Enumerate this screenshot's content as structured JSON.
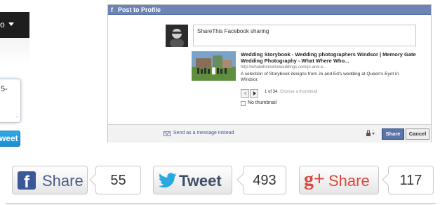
{
  "left_panel": {
    "bar_text": "o",
    "box_text": "5-",
    "tweet_label": "weet"
  },
  "fb_dialog": {
    "logo": "f",
    "title": "Post to Profile",
    "message": "ShareThis Facebook sharing",
    "link_title": "Wedding Storybook - Wedding photographers Windsor | Memory Gate Wedding Photography - What Where Who...",
    "link_url": "http://whatwherewhoweddings.com/jo-and-e...",
    "link_description": "A selection of Storybook designs from Jo and Ed's wedding at Queen's Eyot in Windsor.",
    "pager_count": "1 of 34",
    "pager_choose": "Choose a thumbnail",
    "no_thumbnail": "No thumbnail",
    "send_message": "Send as a message instead",
    "share_label": "Share",
    "cancel_label": "Cancel"
  },
  "social_buttons": {
    "facebook": {
      "label": "Share",
      "count": "55",
      "icon": "facebook-f-icon",
      "color": "#3b5998"
    },
    "twitter": {
      "label": "Tweet",
      "count": "493",
      "icon": "twitter-bird-icon",
      "color": "#2aa9e0"
    },
    "googleplus": {
      "g_letter": "g+",
      "label": "Share",
      "count": "117",
      "icon": "google-plus-icon",
      "color": "#d9483b"
    }
  }
}
